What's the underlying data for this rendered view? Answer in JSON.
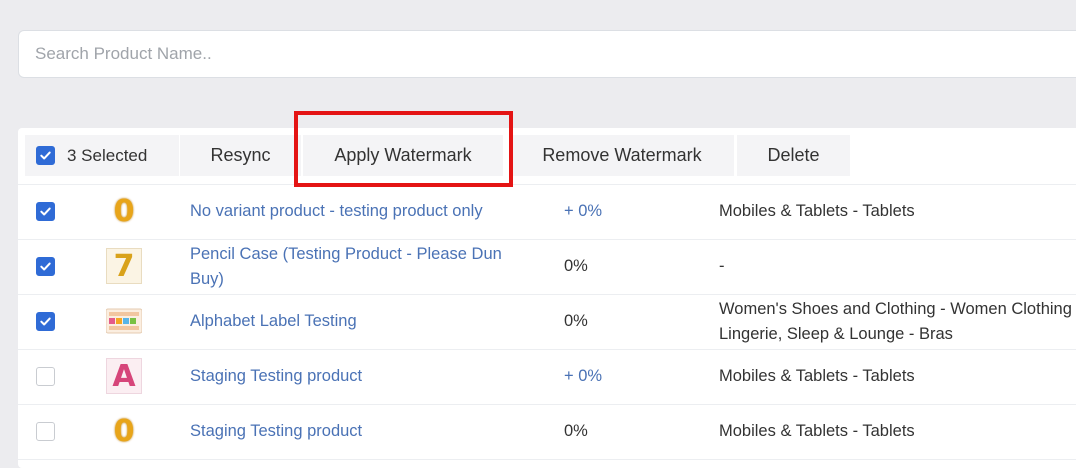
{
  "search": {
    "placeholder": "Search Product Name.."
  },
  "toolbar": {
    "selected_label": "3 Selected",
    "resync_label": "Resync",
    "apply_watermark_label": "Apply Watermark",
    "remove_watermark_label": "Remove Watermark",
    "delete_label": "Delete"
  },
  "rows": [
    {
      "checked": true,
      "thumb": "gold-number-0-image",
      "name": "No variant product - testing product only",
      "percent": "+ 0%",
      "category": "Mobiles & Tablets - Tablets"
    },
    {
      "checked": true,
      "thumb": "gold-number-7-image",
      "name": "Pencil Case (Testing Product - Please Dun Buy)",
      "percent": "0%",
      "category": "-"
    },
    {
      "checked": true,
      "thumb": "alphabet-label-image",
      "name": "Alphabet Label Testing",
      "percent": "0%",
      "category": "Women's Shoes and Clothing - Women Clothing - Lingerie, Sleep & Lounge - Bras"
    },
    {
      "checked": false,
      "thumb": "pink-letter-a-image",
      "name": "Staging Testing product",
      "percent": "+ 0%",
      "category": "Mobiles & Tablets - Tablets"
    },
    {
      "checked": false,
      "thumb": "gold-number-0-image",
      "name": "Staging Testing product",
      "percent": "0%",
      "category": "Mobiles & Tablets - Tablets"
    }
  ],
  "colors": {
    "accent": "#2f6bd6",
    "link": "#4a72b5",
    "highlight": "#e41414"
  }
}
